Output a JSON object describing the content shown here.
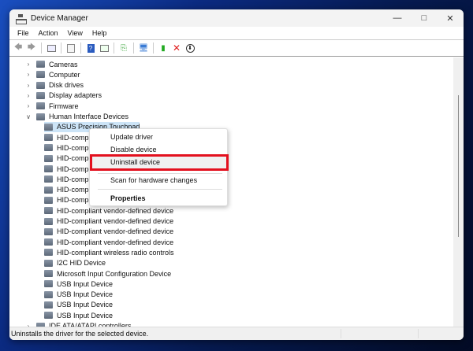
{
  "window": {
    "title": "Device Manager",
    "controls": [
      "minimize",
      "maximize",
      "close"
    ]
  },
  "menu": [
    "File",
    "Action",
    "View",
    "Help"
  ],
  "toolbar": [
    "back-icon",
    "forward-icon",
    "show-hide-tree-icon",
    "properties-icon",
    "help-icon",
    "action-pane-icon",
    "update-driver-icon",
    "scan-hardware-icon",
    "enable-device-icon",
    "uninstall-icon",
    "download-icon"
  ],
  "tree": [
    {
      "label": "Cameras",
      "level": 0,
      "expand": ">"
    },
    {
      "label": "Computer",
      "level": 0,
      "expand": ">"
    },
    {
      "label": "Disk drives",
      "level": 0,
      "expand": ">"
    },
    {
      "label": "Display adapters",
      "level": 0,
      "expand": ">"
    },
    {
      "label": "Firmware",
      "level": 0,
      "expand": ">"
    },
    {
      "label": "Human Interface Devices",
      "level": 0,
      "expand": "v"
    },
    {
      "label": "ASUS Precision Touchpad",
      "level": 1,
      "selected": true
    },
    {
      "label": "HID-compliant consumer control device",
      "level": 1
    },
    {
      "label": "HID-compliant consumer control device",
      "level": 1
    },
    {
      "label": "HID-compliant pen",
      "level": 1
    },
    {
      "label": "HID-compliant system controller",
      "level": 1
    },
    {
      "label": "HID-compliant touch pad",
      "level": 1
    },
    {
      "label": "HID-compliant vendor-defined device",
      "level": 1
    },
    {
      "label": "HID-compliant vendor-defined device",
      "level": 1
    },
    {
      "label": "HID-compliant vendor-defined device",
      "level": 1
    },
    {
      "label": "HID-compliant vendor-defined device",
      "level": 1
    },
    {
      "label": "HID-compliant vendor-defined device",
      "level": 1
    },
    {
      "label": "HID-compliant vendor-defined device",
      "level": 1
    },
    {
      "label": "HID-compliant wireless radio controls",
      "level": 1
    },
    {
      "label": "I2C HID Device",
      "level": 1
    },
    {
      "label": "Microsoft Input Configuration Device",
      "level": 1
    },
    {
      "label": "USB Input Device",
      "level": 1
    },
    {
      "label": "USB Input Device",
      "level": 1
    },
    {
      "label": "USB Input Device",
      "level": 1
    },
    {
      "label": "USB Input Device",
      "level": 1
    },
    {
      "label": "IDE ATA/ATAPI controllers",
      "level": 0,
      "expand": ">"
    }
  ],
  "context_menu": {
    "items": [
      "Update driver",
      "Disable device",
      "Uninstall device",
      "Scan for hardware changes",
      "Properties"
    ],
    "highlighted": "Uninstall device",
    "highlight_color": "#e3101e"
  },
  "status": "Uninstalls the driver for the selected device."
}
